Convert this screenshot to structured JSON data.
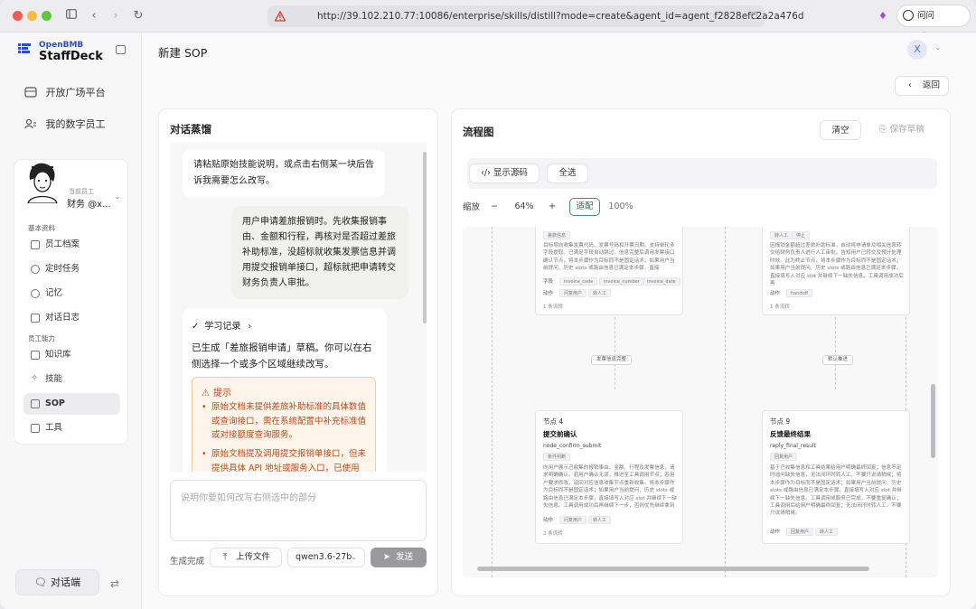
{
  "browser": {
    "url": "http://39.102.210.77:10086/enterprise/skills/distill?mode=create&agent_id=agent_f2828efc2a2a476d",
    "chatgpt_label": "问问 ChatGPT"
  },
  "sidebar": {
    "logo_top": "OpenBMB",
    "logo_bottom": "StaffDeck",
    "top_items": [
      {
        "label": "开放广场平台",
        "icon": "grid-icon"
      },
      {
        "label": "我的数字员工",
        "icon": "users-icon"
      }
    ],
    "user": {
      "caption": "当前员工",
      "name": "财务 @x..."
    },
    "section_basic": "基本资料",
    "basic_items": [
      "员工档案",
      "定时任务",
      "记忆",
      "对话日志"
    ],
    "section_ability": "员工能力",
    "ability_items": [
      "知识库",
      "技能",
      "SOP",
      "工具"
    ],
    "active_item": "SOP",
    "chat_button": "对话端"
  },
  "header": {
    "title": "新建 SOP",
    "avatar_letter": "X",
    "back_label": "返回"
  },
  "left_panel": {
    "title": "对话蒸馏",
    "bubble_left": "请粘贴原始技能说明，或点击右侧某一块后告诉我需要怎么改写。",
    "bubble_right": "用户申请差旅报销时。先收集报销事由、金额和行程，再核对是否超过差旅补助标准，没超标就收集发票信息并调用提交报销单接口，超标就把申请转交财务负责人审批。",
    "learn_label": "学习记录",
    "bot_text": "已生成「差旅报销申请」草稿。你可以在右侧选择一个或多个区域继续改写。",
    "tip_title": "提示",
    "tips": [
      "原始文档未提供差旅补助标准的具体数值或查询接口，需在系统配置中补充标准值或对接额度查询服务。",
      "原始文档提及调用提交报销单接口，但未提供具体 API 地址或服务入口，已使用 available_tools 中的 expense.submit 替代。"
    ],
    "input_placeholder": "说明你要如何改写右侧选中的部分",
    "status": "生成完成",
    "upload_label": "上传文件",
    "model": "qwen3.6-27b",
    "send_label": "发送"
  },
  "right_panel": {
    "title": "流程图",
    "clear_label": "清空",
    "save_label": "保存草稿",
    "show_source": "显示源码",
    "select_all": "全选",
    "zoom_label": "缩放",
    "zoom_minus": "−",
    "zoom_value": "64%",
    "zoom_plus": "+",
    "fit_label": "适配",
    "full_label": "100%",
    "nodes_top": [
      {
        "tag": "差旅信息",
        "desc": "目标导向收集发票代码、发票号码和开票日期。支持单轮多字段提取。已满足字段自动跳过。信息完整后调用发票接口确认节点，将本步骤作为目标而不是固定话术；如果用户当前提问、历史 slots 或路由信息已满足本步骤，直接",
        "fields_label": "字段",
        "fields": [
          "invoice_code",
          "invoice_number",
          "invoice_date"
        ],
        "actions_label": "动作",
        "actions": [
          "问复用户",
          "转人工"
        ],
        "count": "1 条流转"
      },
      {
        "tags": [
          "转人工",
          "停止"
        ],
        "desc": "因报销金额超过差旅补助标准，自动将申请单及相关信息转交给财务负责人进行人工审批。告知用户已转交及预计处理时效。此为终止节点，将本步骤作为目标而不是固定话术；如果用户当前提问、历史 slots 或路由信息已满足本步骤，直接填写入对应 slot 并继续下一缺失信息。工具调用成功后再",
        "actions_label": "动作",
        "actions": [
          "handoff"
        ],
        "count": "1 条流转"
      }
    ],
    "edge_labels": [
      "发票信息完整",
      "默认推进"
    ],
    "nodes_bottom": [
      {
        "label": "节点 4",
        "title": "提交前确认",
        "id": "node_confirm_submit",
        "tag": "条件判断",
        "desc": "向用户展示已收集的报销事由、金额、行程及发票信息，请求明确确认。若用户确认无误，推进至工具调用节点；若用户要求修改，返回对应信息收集节点重新收集。将本步骤作为目标而不是固定话术；如果用户当前提问、历史 slots 或路由信息已满足本步骤，直接填写入对应 slot 并继续下一缺失信息。工具调用成功后再继续下一步，否则优先继续拿到结果后再推进。",
        "actions_label": "动作",
        "actions": [
          "问复用户",
          "转人工"
        ],
        "count": "2 条流转"
      },
      {
        "label": "节点 9",
        "title": "反馈最终结果",
        "id": "reply_final_result",
        "tag": "回复用户",
        "desc": "基于已收集信息和工具结果给用户明确最终回复；信息不足时追问缺失信息，无法闭环时转人工。不要只说请稍候；将本步骤作为目标而不是固定话术；如果用户当前提问、历史 slots 或路由信息已满足本步骤，直接填写入对应 slot 并继续下一缺失信息。工具调用或服务已完成，不要重复确认；工具调用后给用户明确最终回复；无法闭环时转人工，不要只说请稍候。",
        "actions_label": "动作",
        "actions": [
          "回复用户",
          "转人工"
        ]
      }
    ]
  },
  "colors": {
    "brand": "#2b4dd6",
    "warning_text": "#c24a1c",
    "warning_bg": "#fdf4ea",
    "send_disabled": "#9a9a9e"
  }
}
